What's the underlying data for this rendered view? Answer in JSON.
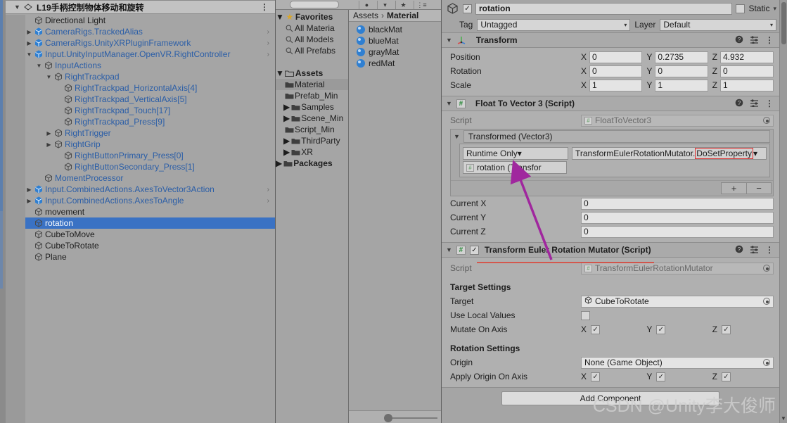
{
  "hierarchy": {
    "scene_name": "L19手柄控制物体移动和旋转",
    "kebab": "⋮",
    "items": [
      {
        "label": "Directional Light",
        "depth": 1,
        "twisty": "",
        "prefab": false,
        "chevron": false,
        "selected": false
      },
      {
        "label": "CameraRigs.TrackedAlias",
        "depth": 1,
        "twisty": "right",
        "prefab": true,
        "chevron": true,
        "selected": false
      },
      {
        "label": "CameraRigs.UnityXRPluginFramework",
        "depth": 1,
        "twisty": "right",
        "prefab": true,
        "chevron": true,
        "selected": false
      },
      {
        "label": "Input.UnityInputManager.OpenVR.RightController",
        "depth": 1,
        "twisty": "down",
        "prefab": true,
        "chevron": true,
        "selected": false
      },
      {
        "label": "InputActions",
        "depth": 2,
        "twisty": "down",
        "prefab": false,
        "blue": true,
        "chevron": false,
        "selected": false
      },
      {
        "label": "RightTrackpad",
        "depth": 3,
        "twisty": "down",
        "prefab": false,
        "blue": true,
        "chevron": false,
        "selected": false
      },
      {
        "label": "RightTrackpad_HorizontalAxis[4]",
        "depth": 4,
        "twisty": "",
        "prefab": false,
        "blue": true,
        "chevron": false,
        "selected": false
      },
      {
        "label": "RightTrackpad_VerticalAxis[5]",
        "depth": 4,
        "twisty": "",
        "prefab": false,
        "blue": true,
        "chevron": false,
        "selected": false
      },
      {
        "label": "RightTrackpad_Touch[17]",
        "depth": 4,
        "twisty": "",
        "prefab": false,
        "blue": true,
        "chevron": false,
        "selected": false
      },
      {
        "label": "RightTrackpad_Press[9]",
        "depth": 4,
        "twisty": "",
        "prefab": false,
        "blue": true,
        "chevron": false,
        "selected": false
      },
      {
        "label": "RightTrigger",
        "depth": 3,
        "twisty": "right",
        "prefab": false,
        "blue": true,
        "chevron": false,
        "selected": false
      },
      {
        "label": "RightGrip",
        "depth": 3,
        "twisty": "right",
        "prefab": false,
        "blue": true,
        "chevron": false,
        "selected": false
      },
      {
        "label": "RightButtonPrimary_Press[0]",
        "depth": 4,
        "twisty": "",
        "prefab": false,
        "blue": true,
        "chevron": false,
        "selected": false
      },
      {
        "label": "RightButtonSecondary_Press[1]",
        "depth": 4,
        "twisty": "",
        "prefab": false,
        "blue": true,
        "chevron": false,
        "selected": false
      },
      {
        "label": "MomentProcessor",
        "depth": 2,
        "twisty": "",
        "prefab": false,
        "blue": true,
        "chevron": false,
        "selected": false
      },
      {
        "label": "Input.CombinedActions.AxesToVector3Action",
        "depth": 1,
        "twisty": "right",
        "prefab": true,
        "chevron": true,
        "selected": false
      },
      {
        "label": "Input.CombinedActions.AxesToAngle",
        "depth": 1,
        "twisty": "right",
        "prefab": true,
        "chevron": true,
        "selected": false
      },
      {
        "label": "movement",
        "depth": 1,
        "twisty": "",
        "prefab": false,
        "chevron": false,
        "selected": false
      },
      {
        "label": "rotation",
        "depth": 1,
        "twisty": "",
        "prefab": false,
        "chevron": false,
        "selected": true
      },
      {
        "label": "CubeToMove",
        "depth": 1,
        "twisty": "",
        "prefab": false,
        "chevron": false,
        "selected": false
      },
      {
        "label": "CubeToRotate",
        "depth": 1,
        "twisty": "",
        "prefab": false,
        "chevron": false,
        "selected": false
      },
      {
        "label": "Plane",
        "depth": 1,
        "twisty": "",
        "prefab": false,
        "chevron": false,
        "selected": false
      }
    ]
  },
  "project": {
    "tree": [
      {
        "label": "Favorites",
        "depth": 0,
        "twisty": "down",
        "icon": "star",
        "bold": true,
        "selected": false
      },
      {
        "label": "All Materia",
        "depth": 1,
        "twisty": "",
        "icon": "search",
        "bold": false,
        "selected": false
      },
      {
        "label": "All Models",
        "depth": 1,
        "twisty": "",
        "icon": "search",
        "bold": false,
        "selected": false
      },
      {
        "label": "All Prefabs",
        "depth": 1,
        "twisty": "",
        "icon": "search",
        "bold": false,
        "selected": false
      },
      {
        "label": "",
        "depth": 0,
        "twisty": "",
        "icon": "none",
        "bold": false,
        "selected": false
      },
      {
        "label": "Assets",
        "depth": 0,
        "twisty": "down",
        "icon": "folder-open",
        "bold": true,
        "selected": false
      },
      {
        "label": "Material",
        "depth": 1,
        "twisty": "",
        "icon": "folder",
        "bold": false,
        "selected": true
      },
      {
        "label": "Prefab_Min",
        "depth": 1,
        "twisty": "",
        "icon": "folder",
        "bold": false,
        "selected": false
      },
      {
        "label": "Samples",
        "depth": 1,
        "twisty": "right",
        "icon": "folder",
        "bold": false,
        "selected": false
      },
      {
        "label": "Scene_Min",
        "depth": 1,
        "twisty": "right",
        "icon": "folder",
        "bold": false,
        "selected": false
      },
      {
        "label": "Script_Min",
        "depth": 1,
        "twisty": "",
        "icon": "folder",
        "bold": false,
        "selected": false
      },
      {
        "label": "ThirdParty",
        "depth": 1,
        "twisty": "right",
        "icon": "folder",
        "bold": false,
        "selected": false
      },
      {
        "label": "XR",
        "depth": 1,
        "twisty": "right",
        "icon": "folder",
        "bold": false,
        "selected": false
      },
      {
        "label": "Packages",
        "depth": 0,
        "twisty": "right",
        "icon": "folder",
        "bold": true,
        "selected": false
      }
    ],
    "breadcrumb": [
      "Assets",
      "Material"
    ],
    "breadcrumb_sep": "›",
    "assets": [
      {
        "name": "blackMat",
        "icon": "material-icon"
      },
      {
        "name": "blueMat",
        "icon": "material-icon"
      },
      {
        "name": "grayMat",
        "icon": "material-icon"
      },
      {
        "name": "redMat",
        "icon": "material-icon"
      }
    ]
  },
  "inspector": {
    "object_name": "rotation",
    "enabled": true,
    "static_label": "Static",
    "static_checked": false,
    "tag_label": "Tag",
    "tag_value": "Untagged",
    "layer_label": "Layer",
    "layer_value": "Default",
    "transform": {
      "title": "Transform",
      "rows": [
        {
          "label": "Position",
          "x": "0",
          "y": "0.2735",
          "z": "4.932"
        },
        {
          "label": "Rotation",
          "x": "0",
          "y": "0",
          "z": "0"
        },
        {
          "label": "Scale",
          "x": "1",
          "y": "1",
          "z": "1"
        }
      ],
      "axis_labels": [
        "X",
        "Y",
        "Z"
      ]
    },
    "float_to_vector3": {
      "title": "Float To Vector 3 (Script)",
      "script_label": "Script",
      "script_value": "FloatToVector3",
      "event_title": "Transformed (Vector3)",
      "event_mode": "Runtime Only",
      "event_function_prefix": "TransformEulerRotationMutator.",
      "event_function_highlight": "DoSetProperty",
      "event_target": "rotation (Transfor",
      "add_button": "+",
      "remove_button": "−",
      "current_rows": [
        {
          "label": "Current X",
          "value": "0"
        },
        {
          "label": "Current Y",
          "value": "0"
        },
        {
          "label": "Current Z",
          "value": "0"
        }
      ]
    },
    "euler_mutator": {
      "title": "Transform Euler Rotation Mutator (Script)",
      "enabled": true,
      "script_label": "Script",
      "script_value": "TransformEulerRotationMutator",
      "target_settings_title": "Target Settings",
      "target_label": "Target",
      "target_value": "CubeToRotate",
      "use_local_label": "Use Local Values",
      "use_local_checked": false,
      "mutate_axis_label": "Mutate On Axis",
      "mutate_axis": [
        {
          "axis": "X",
          "checked": true
        },
        {
          "axis": "Y",
          "checked": true
        },
        {
          "axis": "Z",
          "checked": true
        }
      ],
      "rotation_settings_title": "Rotation Settings",
      "origin_label": "Origin",
      "origin_value": "None (Game Object)",
      "apply_origin_label": "Apply Origin On Axis",
      "apply_origin_axis": [
        {
          "axis": "X",
          "checked": true
        },
        {
          "axis": "Y",
          "checked": true
        },
        {
          "axis": "Z",
          "checked": true
        }
      ]
    },
    "add_component_label": "Add Component",
    "help_icon": "help-icon",
    "preset_icon": "preset-icon",
    "menu_icon": "kebab-menu-icon"
  },
  "watermark": "CSDN @Unity李大俊师",
  "colors": {
    "selection_blue": "#3a72c4",
    "prefab_blue": "#2b5ea7",
    "annotation_purple": "#a0279e",
    "highlight_red": "#e02b2b",
    "panel_bg": "#a5a5a5"
  }
}
